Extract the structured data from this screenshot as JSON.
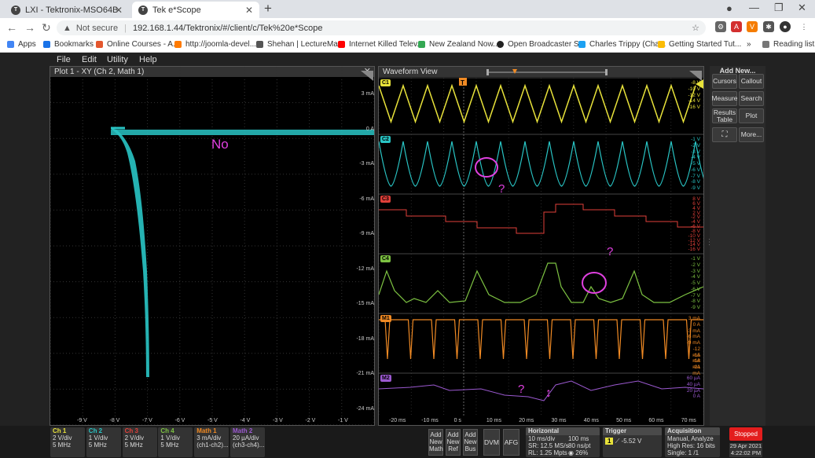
{
  "browser": {
    "tabs": [
      {
        "title": "LXI - Tektronix-MSO64B",
        "icon": "T",
        "close": "✕"
      },
      {
        "title": "Tek e*Scope",
        "icon": "T",
        "close": "✕"
      }
    ],
    "new_tab": "+",
    "url_warning": "Not secure",
    "url": "192.168.1.44/Tektronix/#/client/c/Tek%20e*Scope",
    "bookmarks": [
      {
        "label": "Apps",
        "color": "#4285f4"
      },
      {
        "label": "Bookmarks",
        "color": "#1a73e8"
      },
      {
        "label": "Online Courses - A...",
        "color": "#e4572e"
      },
      {
        "label": "http://joomla-devel...",
        "color": "#ff7a00"
      },
      {
        "label": "Shehan | LectureMa...",
        "color": "#555555"
      },
      {
        "label": "Internet Killed Telev...",
        "color": "#ff0000"
      },
      {
        "label": "New Zealand Now...",
        "color": "#34a853"
      },
      {
        "label": "Open Broadcaster S...",
        "color": "#222222"
      },
      {
        "label": "Charles Trippy (Cha...",
        "color": "#1da1f2"
      },
      {
        "label": "Getting Started Tut...",
        "color": "#fbbc05"
      }
    ],
    "more_bookmarks": "»",
    "reading_list": "Reading list"
  },
  "menu": [
    "File",
    "Edit",
    "Utility",
    "Help"
  ],
  "plot1": {
    "title": "Plot 1 - XY (Ch 2, Math 1)",
    "close": "✕",
    "annotation": "No",
    "y_ticks": [
      "3 mA",
      "0 A",
      "-3 mA",
      "-6 mA",
      "-9 mA",
      "-12 mA",
      "-15 mA",
      "-18 mA",
      "-21 mA",
      "-24 mA"
    ],
    "x_ticks": [
      "-9 V",
      "-8 V",
      "-7 V",
      "-6 V",
      "-5 V",
      "-4 V",
      "-3 V",
      "-2 V",
      "-1 V"
    ],
    "trace_color": "#29c5c5"
  },
  "waveform": {
    "title": "Waveform View",
    "x_ticks": [
      "-20 ms",
      "-10 ms",
      "0 s",
      "10 ms",
      "20 ms",
      "30 ms",
      "40 ms",
      "50 ms",
      "60 ms",
      "70 ms"
    ],
    "channels": [
      {
        "tag": "C1",
        "color": "#e8e23a",
        "labels": [
          "-8 V",
          "-10 V",
          "-12 V",
          "-14 V",
          "-16 V"
        ]
      },
      {
        "tag": "C2",
        "color": "#29c5c5",
        "labels": [
          "-1 V",
          "-2 V",
          "-3 V",
          "-4 V",
          "-5 V",
          "-6 V",
          "-7 V",
          "-8 V",
          "-9 V"
        ]
      },
      {
        "tag": "C3",
        "color": "#e0403a",
        "labels": [
          "8 V",
          "6 V",
          "4 V",
          "2 V",
          "-2 V",
          "-4 V",
          "-6 V",
          "-8 V",
          "-10 V",
          "-12 V",
          "-14 V",
          "-16 V"
        ]
      },
      {
        "tag": "C4",
        "color": "#7dc242",
        "labels": [
          "-1 V",
          "-2 V",
          "-3 V",
          "-4 V",
          "-5 V",
          "-6 V",
          "-7 V",
          "-8 V",
          "-9 V"
        ]
      },
      {
        "tag": "M1",
        "color": "#f08a24",
        "labels": [
          "3 mA",
          "0 A",
          "-3 mA",
          "-6 mA",
          "-9 mA",
          "-12 mA",
          "-15 mA",
          "-18 mA",
          "-21 mA"
        ]
      },
      {
        "tag": "M2",
        "color": "#9b59d0",
        "labels": [
          "60 µA",
          "40 µA",
          "20 µA",
          "0 A"
        ]
      }
    ],
    "annotations": [
      "?",
      "?",
      "?",
      "↕"
    ],
    "trigger_marker": "T"
  },
  "sidebar": {
    "title": "Add New...",
    "buttons": [
      "Cursors",
      "Callout",
      "Measure",
      "Search",
      "Results Table",
      "Plot",
      "",
      "More..."
    ]
  },
  "bottom": {
    "channels": [
      {
        "label": "Ch 1",
        "color": "#e8e23a",
        "l1": "2 V/div",
        "l2": "",
        "l3": "5 MHz"
      },
      {
        "label": "Ch 2",
        "color": "#29c5c5",
        "l1": "1 V/div",
        "l2": "",
        "l3": "5 MHz"
      },
      {
        "label": "Ch 3",
        "color": "#e0403a",
        "l1": "2 V/div",
        "l2": "",
        "l3": "5 MHz"
      },
      {
        "label": "Ch 4",
        "color": "#7dc242",
        "l1": "1 V/div",
        "l2": "",
        "l3": "5 MHz"
      },
      {
        "label": "Math 1",
        "color": "#f08a24",
        "l1": "3 mA/div",
        "l2": "(ch1-ch2)...",
        "l3": ""
      },
      {
        "label": "Math 2",
        "color": "#9b59d0",
        "l1": "20 µA/div",
        "l2": "(ch3-ch4)...",
        "l3": ""
      }
    ],
    "add_buttons": [
      "Add New Math",
      "Add New Ref",
      "Add New Bus"
    ],
    "dvm": "DVM",
    "afg": "AFG",
    "horizontal": {
      "title": "Horizontal",
      "r1a": "10 ms/div",
      "r1b": "100 ms",
      "r2a": "SR: 12.5 MS/s",
      "r2b": "80 ns/pt",
      "r3a": "RL: 1.25 Mpts",
      "r3b": "26%"
    },
    "trigger": {
      "title": "Trigger",
      "ch": "1",
      "value": "-5.52 V"
    },
    "acquisition": {
      "title": "Acquisition",
      "r1a": "Manual,",
      "r1b": "Analyze",
      "r2": "High Res: 16 bits",
      "r3": "Single: 1 /1"
    },
    "status": "Stopped",
    "date": "29 Apr 2021",
    "time": "4:22:02 PM"
  }
}
